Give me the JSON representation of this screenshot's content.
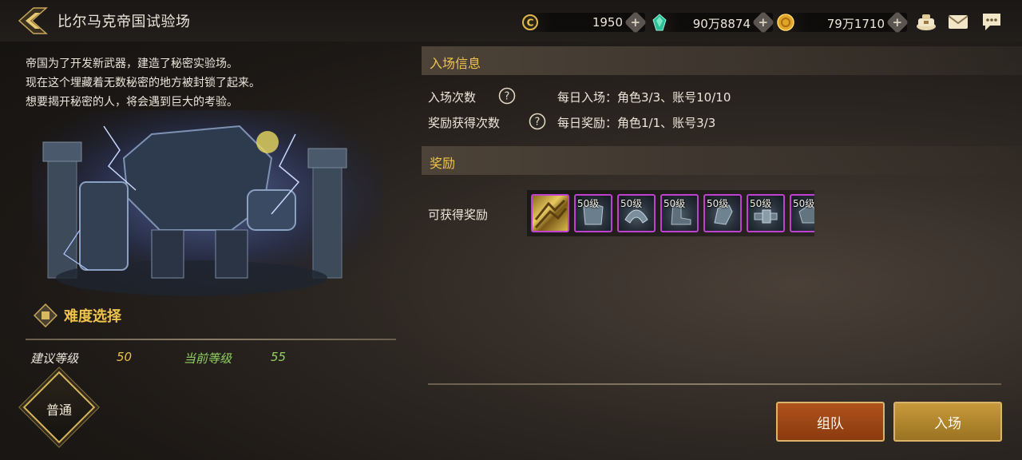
{
  "header": {
    "title": "比尔马克帝国试验场"
  },
  "currencies": [
    {
      "icon": "coin-c-icon",
      "value": "1950"
    },
    {
      "icon": "green-gem-icon",
      "value": "90万8874"
    },
    {
      "icon": "gold-coin-icon",
      "value": "79万1710"
    }
  ],
  "top_icons": [
    "treasure-bag-icon",
    "mail-icon",
    "chat-icon"
  ],
  "description": {
    "lines": [
      "帝国为了开发新武器，建造了秘密实验场。",
      "现在这个埋藏着无数秘密的地方被封锁了起来。",
      "想要揭开秘密的人，将会遇到巨大的考验。"
    ]
  },
  "difficulty": {
    "title": "难度选择",
    "recommended_label": "建议等级",
    "recommended_value": "50",
    "current_label": "当前等级",
    "current_value": "55",
    "selected": "普通"
  },
  "entry_info": {
    "title": "入场信息",
    "entries_label": "入场次数",
    "entries_value": "每日入场：角色3/3、账号10/10",
    "rewards_label": "奖励获得次数",
    "rewards_value": "每日奖励：角色1/1、账号3/3"
  },
  "rewards": {
    "title": "奖励",
    "label": "可获得奖励",
    "items": [
      {
        "level": "",
        "icon": "gold-material-icon"
      },
      {
        "level": "50级",
        "icon": "armor-icon"
      },
      {
        "level": "50级",
        "icon": "shoulder-armor-icon"
      },
      {
        "level": "50级",
        "icon": "boots-icon"
      },
      {
        "level": "50级",
        "icon": "gauntlet-icon"
      },
      {
        "level": "50级",
        "icon": "belt-icon"
      },
      {
        "level": "50级",
        "icon": "gear-piece-icon"
      }
    ]
  },
  "buttons": {
    "team": "组队",
    "enter": "入场"
  },
  "colors": {
    "accent_gold": "#f0c44a",
    "recommended_level": "#e8c04a",
    "current_level": "#8fd060",
    "reward_border": "#c040d0",
    "team_button": "#a84a18",
    "enter_button": "#b88a30"
  }
}
